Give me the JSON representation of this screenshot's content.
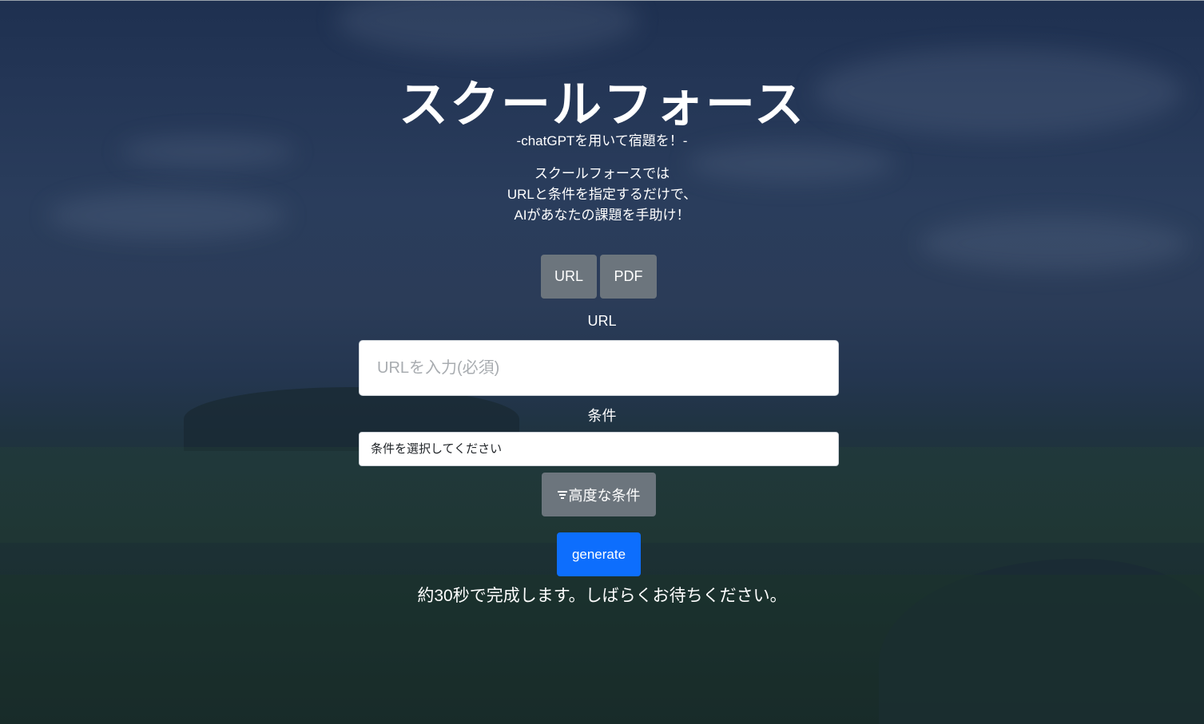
{
  "header": {
    "title": "スクールフォース",
    "subtitle": "-chatGPTを用いて宿題を！-",
    "description_lines": [
      "スクールフォースでは",
      "URLと条件を指定するだけで、",
      "AIがあなたの課題を手助け！"
    ]
  },
  "mode_buttons": {
    "url": "URL",
    "pdf": "PDF"
  },
  "form": {
    "url_label": "URL",
    "url_placeholder": "URLを入力(必須)",
    "url_value": "",
    "condition_label": "条件",
    "condition_selected": "条件を選択してください",
    "advanced_button": "高度な条件",
    "generate_button": "generate"
  },
  "notice": "約30秒で完成します。しばらくお待ちください。",
  "colors": {
    "primary": "#0d6efd",
    "secondary": "#6c757d",
    "text": "#ffffff"
  },
  "icons": {
    "advanced": "filter-icon"
  }
}
